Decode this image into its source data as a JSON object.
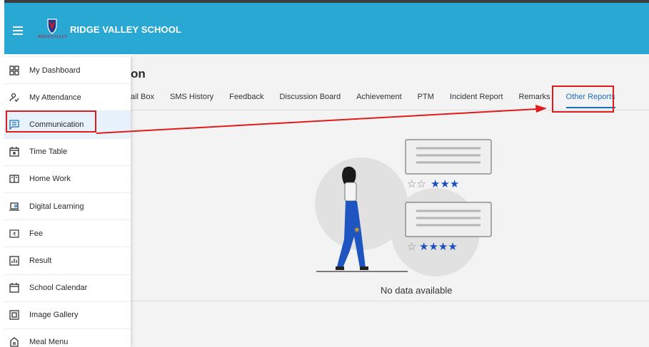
{
  "header": {
    "school_name": "RIDGE VALLEY SCHOOL",
    "logo_text": "RIDGEVALLEY"
  },
  "page": {
    "title": "on"
  },
  "tabs": [
    {
      "label": "ail Box"
    },
    {
      "label": "SMS History"
    },
    {
      "label": "Feedback"
    },
    {
      "label": "Discussion Board"
    },
    {
      "label": "Achievement"
    },
    {
      "label": "PTM"
    },
    {
      "label": "Incident Report"
    },
    {
      "label": "Remarks"
    },
    {
      "label": "Other Reports",
      "active": true
    }
  ],
  "empty_state": {
    "message": "No data available"
  },
  "sidebar": {
    "items": [
      {
        "label": "My Dashboard",
        "icon": "dashboard-icon"
      },
      {
        "label": "My Attendance",
        "icon": "attendance-icon"
      },
      {
        "label": "Communication",
        "icon": "chat-icon",
        "highlighted": true
      },
      {
        "label": "Time Table",
        "icon": "calendar-icon"
      },
      {
        "label": "Home Work",
        "icon": "book-icon"
      },
      {
        "label": "Digital Learning",
        "icon": "laptop-user-icon"
      },
      {
        "label": "Fee",
        "icon": "rupee-icon"
      },
      {
        "label": "Result",
        "icon": "bar-chart-icon"
      },
      {
        "label": "School Calendar",
        "icon": "calendar-icon"
      },
      {
        "label": "Image Gallery",
        "icon": "image-icon"
      },
      {
        "label": "Meal Menu",
        "icon": "meal-icon"
      }
    ]
  },
  "colors": {
    "header": "#29a8d4",
    "accent": "#1a6fc0",
    "highlight": "#e01b1b",
    "sidebar_active": "#e8f2fd"
  }
}
